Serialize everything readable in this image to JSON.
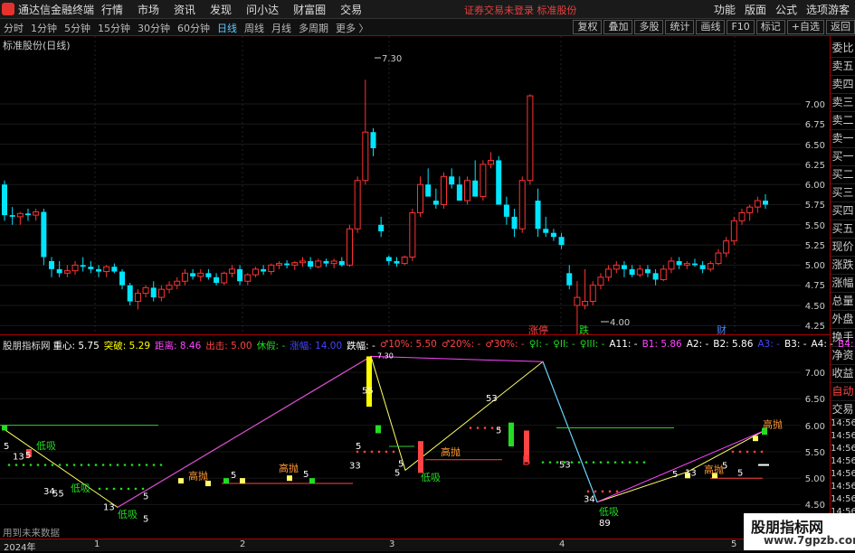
{
  "topbar": {
    "app_title": "通达信金融终端",
    "menu": [
      "行情",
      "市场",
      "资讯",
      "发现",
      "问小达",
      "财富圈",
      "交易"
    ],
    "alert": "证券交易未登录  标准股份",
    "right_menu": [
      "功能",
      "版面",
      "公式",
      "选项"
    ],
    "guest": "游客"
  },
  "toolbar": {
    "periods": [
      "分时",
      "1分钟",
      "5分钟",
      "15分钟",
      "30分钟",
      "60分钟",
      "日线",
      "周线",
      "月线",
      "多周期",
      "更多 〉"
    ],
    "active_period": "日线",
    "tools": [
      "复权",
      "叠加",
      "多股",
      "统计",
      "画线",
      "F10",
      "标记",
      "+自选",
      "返回"
    ]
  },
  "main_chart": {
    "title": "标准股份(日线)",
    "y_ticks": [
      "7.00",
      "6.75",
      "6.50",
      "6.25",
      "6.00",
      "5.75",
      "5.50",
      "5.25",
      "5.00",
      "4.75",
      "4.50",
      "4.25",
      "4.00"
    ],
    "high_label": "7.30",
    "low_label": "4.00",
    "markers": [
      "涨停",
      "跌",
      "财"
    ]
  },
  "right_panel": {
    "items": [
      "委比",
      "卖五",
      "卖四",
      "卖三",
      "卖二",
      "卖一",
      "买一",
      "买二",
      "买三",
      "买四",
      "买五",
      "现价",
      "涨跌",
      "涨幅",
      "总量",
      "外盘",
      "换手",
      "净资",
      "收益",
      "自动",
      "交易"
    ]
  },
  "indicator": {
    "name": "股朋指标网",
    "fields": [
      {
        "label": "重心:",
        "value": "5.75",
        "color": "#ffffff"
      },
      {
        "label": "突破:",
        "value": "5.29",
        "color": "#ffff00"
      },
      {
        "label": "距离:",
        "value": "8.46",
        "color": "#ff44ff"
      },
      {
        "label": "出击:",
        "value": "5.00",
        "color": "#ff4444"
      },
      {
        "label": "休假:",
        "value": "-",
        "color": "#22dd22"
      },
      {
        "label": "涨幅:",
        "value": "14.00",
        "color": "#4444ff"
      },
      {
        "label": "跌幅:",
        "value": "-",
        "color": "#ffffff"
      },
      {
        "label": "♂10%:",
        "value": "5.50",
        "color": "#ff4444"
      },
      {
        "label": "♂20%:",
        "value": "-",
        "color": "#ff4444"
      },
      {
        "label": "♂30%:",
        "value": "-",
        "color": "#ff4444"
      },
      {
        "label": "♀I:",
        "value": "-",
        "color": "#22dd22"
      },
      {
        "label": "♀II:",
        "value": "-",
        "color": "#22dd22"
      },
      {
        "label": "♀III:",
        "value": "-",
        "color": "#22dd22"
      },
      {
        "label": "A11:",
        "value": "-",
        "color": "#ffffff"
      },
      {
        "label": "B1:",
        "value": "5.86",
        "color": "#ff44ff"
      },
      {
        "label": "A2:",
        "value": "-",
        "color": "#ffffff"
      },
      {
        "label": "B2:",
        "value": "5.86",
        "color": "#ffffff"
      },
      {
        "label": "A3:",
        "value": "-",
        "color": "#4444ff"
      },
      {
        "label": "B3:",
        "value": "-",
        "color": "#ffffff"
      },
      {
        "label": "A4:",
        "value": "-",
        "color": "#ffffff"
      },
      {
        "label": "B4:",
        "value": "-",
        "color": "#ff44ff"
      }
    ],
    "y_ticks": [
      "7.00",
      "6.50",
      "6.00",
      "5.50",
      "5.00",
      "4.50"
    ],
    "right_ticks": [
      "14:56",
      "14:56",
      "14:56",
      "14:56",
      "14:56",
      "14:56",
      "14:56",
      "14:56",
      "14:56",
      "14:56"
    ],
    "peak_label": "7.30",
    "labels_sell": [
      "高抛",
      "高抛",
      "高抛",
      "高抛",
      "高抛"
    ],
    "labels_buy": [
      "低吸",
      "低吸",
      "低吸",
      "低吸",
      "低吸"
    ],
    "label_b": "B",
    "nums": [
      "5",
      "13",
      "34",
      "55",
      "5",
      "13",
      "5",
      "5",
      "5",
      "33",
      "5",
      "5",
      "5",
      "55",
      "53",
      "5",
      "53",
      "34",
      "89",
      "5",
      "13",
      "5",
      "5",
      "5"
    ],
    "note": "用到未来数据"
  },
  "x_axis": {
    "labels": [
      "2024年",
      "1",
      "2",
      "3",
      "4",
      "5"
    ]
  },
  "watermark": {
    "main": "股朋指标网",
    "sub": "www.7gpzb.com"
  },
  "colors": {
    "up": "#ff3333",
    "down": "#00e5ff",
    "frame": "#aa0000",
    "bg": "#000000"
  }
}
